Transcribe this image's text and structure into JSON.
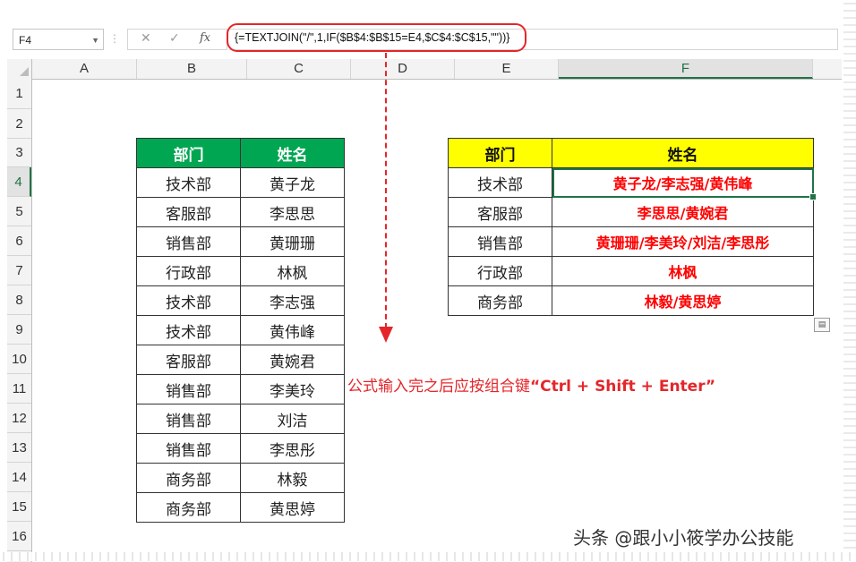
{
  "name_box": {
    "value": "F4",
    "arrow": "▼"
  },
  "formula_bar": {
    "dots": "⋮",
    "cancel_icon": "✕",
    "enter_icon": "✓",
    "fx_label": "fx",
    "formula": "{=TEXTJOIN(\"/\",1,IF($B$4:$B$15=E4,$C$4:$C$15,\"\"))}"
  },
  "columns": [
    "A",
    "B",
    "C",
    "D",
    "E",
    "F"
  ],
  "active_column": "F",
  "rows": [
    "1",
    "2",
    "3",
    "4",
    "5",
    "6",
    "7",
    "8",
    "9",
    "10",
    "11",
    "12",
    "13",
    "14",
    "15",
    "16"
  ],
  "active_row": "4",
  "source_table": {
    "headers": [
      "部门",
      "姓名"
    ],
    "header_color": "#00a651",
    "rows": [
      [
        "技术部",
        "黄子龙"
      ],
      [
        "客服部",
        "李思思"
      ],
      [
        "销售部",
        "黄珊珊"
      ],
      [
        "行政部",
        "林枫"
      ],
      [
        "技术部",
        "李志强"
      ],
      [
        "技术部",
        "黄伟峰"
      ],
      [
        "客服部",
        "黄婉君"
      ],
      [
        "销售部",
        "李美玲"
      ],
      [
        "销售部",
        "刘洁"
      ],
      [
        "销售部",
        "李思彤"
      ],
      [
        "商务部",
        "林毅"
      ],
      [
        "商务部",
        "黄思婷"
      ]
    ]
  },
  "result_table": {
    "headers": [
      "部门",
      "姓名"
    ],
    "header_color": "#ffff00",
    "rows": [
      [
        "技术部",
        "黄子龙/李志强/黄伟峰"
      ],
      [
        "客服部",
        "李思思/黄婉君"
      ],
      [
        "销售部",
        "黄珊珊/李美玲/刘洁/李思彤"
      ],
      [
        "行政部",
        "林枫"
      ],
      [
        "商务部",
        "林毅/黄思婷"
      ]
    ]
  },
  "annotation": {
    "text_a": "公式输入完之后应按组合键",
    "text_b": "“Ctrl + Shift + Enter”",
    "color": "#e4262a"
  },
  "paste_icon": "clipboard-icon",
  "watermark": "头条 @跟小小筱学办公技能"
}
